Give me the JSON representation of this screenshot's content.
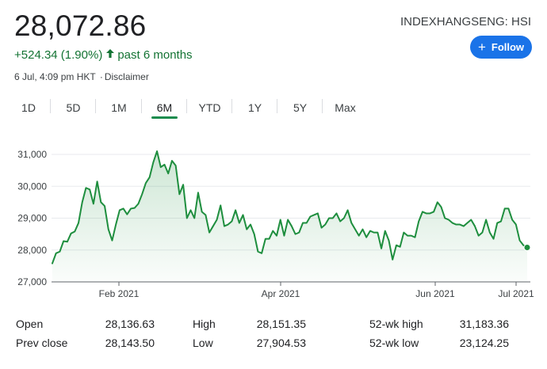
{
  "header": {
    "price": "28,072.86",
    "change": "+524.34 (1.90%)",
    "period": "past 6 months",
    "timestamp": "6 Jul, 4:09 pm HKT",
    "disclaimer": "Disclaimer",
    "ticker": "INDEXHANGSENG: HSI",
    "follow_label": "Follow"
  },
  "tabs": [
    "1D",
    "5D",
    "1M",
    "6M",
    "YTD",
    "1Y",
    "5Y",
    "Max"
  ],
  "active_tab": "6M",
  "colors": {
    "line": "#1e8e3e",
    "accent": "#1a73e8",
    "positive": "#137333"
  },
  "chart_data": {
    "type": "area",
    "ylim": [
      27000,
      31000
    ],
    "yticks": [
      "27,000",
      "28,000",
      "29,000",
      "30,000",
      "31,000"
    ],
    "xticks": [
      "Feb 2021",
      "Apr 2021",
      "Jun 2021",
      "Jul 2021"
    ],
    "grid": true,
    "series": [
      {
        "values": [
          27580,
          27900,
          27950,
          28280,
          28260,
          28520,
          28580,
          28850,
          29500,
          29950,
          29900,
          29450,
          30150,
          29500,
          29380,
          28650,
          28300,
          28800,
          29250,
          29300,
          29120,
          29300,
          29320,
          29450,
          29750,
          30100,
          30280,
          30750,
          31100,
          30600,
          30680,
          30400,
          30800,
          30650,
          29750,
          30050,
          29000,
          29250,
          29000,
          29800,
          29200,
          29100,
          28550,
          28750,
          28950,
          29400,
          28750,
          28800,
          28900,
          29250,
          28850,
          29100,
          28650,
          28800,
          28500,
          27950,
          27900,
          28350,
          28350,
          28600,
          28450,
          28950,
          28450,
          28950,
          28750,
          28500,
          28550,
          28850,
          28850,
          29050,
          29100,
          29150,
          28700,
          28800,
          29000,
          29000,
          29150,
          28900,
          29000,
          29250,
          28850,
          28650,
          28450,
          28650,
          28400,
          28600,
          28550,
          28550,
          28050,
          28600,
          28300,
          27700,
          28150,
          28100,
          28550,
          28450,
          28450,
          28400,
          28900,
          29200,
          29150,
          29150,
          29200,
          29500,
          29350,
          29000,
          28950,
          28850,
          28800,
          28800,
          28750,
          28850,
          28950,
          28750,
          28450,
          28550,
          28950,
          28550,
          28350,
          28850,
          28900,
          29300,
          29300,
          28950,
          28800,
          28300,
          28150,
          28080
        ]
      }
    ]
  },
  "stats": {
    "open_label": "Open",
    "open": "28,136.63",
    "high_label": "High",
    "high": "28,151.35",
    "wk52_high_label": "52-wk high",
    "wk52_high": "31,183.36",
    "prev_close_label": "Prev close",
    "prev_close": "28,143.50",
    "low_label": "Low",
    "low": "27,904.53",
    "wk52_low_label": "52-wk low",
    "wk52_low": "23,124.25"
  }
}
